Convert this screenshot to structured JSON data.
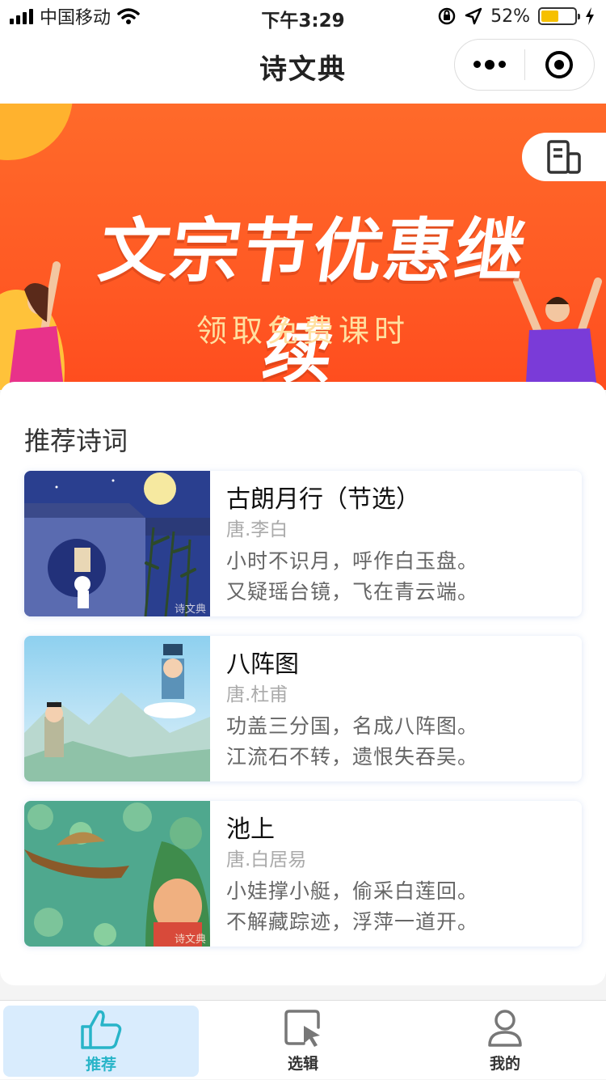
{
  "status_bar": {
    "carrier": "中国移动",
    "time": "下午3:29",
    "battery_percent": "52%",
    "battery_level": 0.52
  },
  "navbar": {
    "title": "诗文典"
  },
  "banner": {
    "headline": "文宗节优惠继续",
    "subtitle": "领取免费课时"
  },
  "recommend": {
    "title": "推荐诗词",
    "poems": [
      {
        "title": "古朗月行（节选）",
        "author": "唐.李白",
        "lines": [
          "小时不识月，呼作白玉盘。",
          "又疑瑶台镜，飞在青云端。"
        ],
        "thumb_watermark": "诗文典"
      },
      {
        "title": "八阵图",
        "author": "唐.杜甫",
        "lines": [
          "功盖三分国，名成八阵图。",
          "江流石不转，遗恨失吞吴。"
        ]
      },
      {
        "title": "池上",
        "author": "唐.白居易",
        "lines": [
          "小娃撑小艇，偷采白莲回。",
          "不解藏踪迹，浮萍一道开。"
        ],
        "thumb_watermark": "诗文典"
      }
    ]
  },
  "tabbar": {
    "items": [
      {
        "label": "推荐",
        "icon": "thumbs-up-icon",
        "active": true
      },
      {
        "label": "选辑",
        "icon": "select-cursor-icon",
        "active": false
      },
      {
        "label": "我的",
        "icon": "user-icon",
        "active": false
      }
    ]
  },
  "colors": {
    "banner_orange": "#ff5a24",
    "tab_active_bg": "#d9ecfd",
    "tab_active_text": "#28b4c8"
  }
}
